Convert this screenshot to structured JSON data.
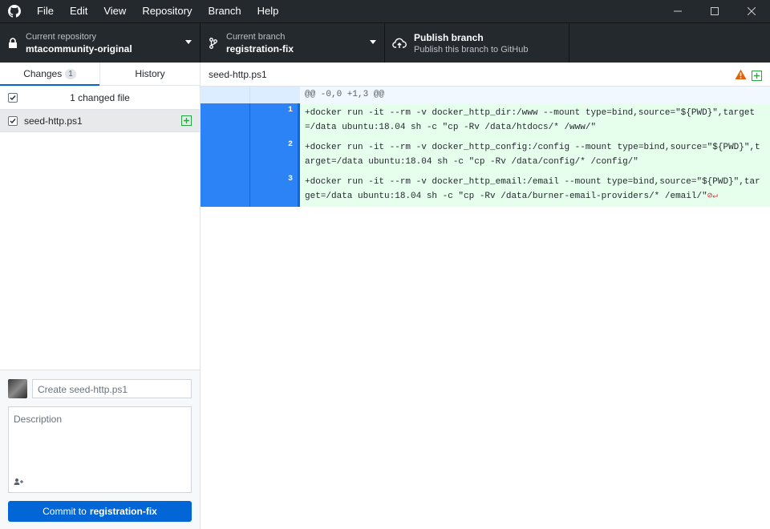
{
  "menu": [
    "File",
    "Edit",
    "View",
    "Repository",
    "Branch",
    "Help"
  ],
  "toolbar": {
    "repo_label": "Current repository",
    "repo_value": "mtacommunity-original",
    "branch_label": "Current branch",
    "branch_value": "registration-fix",
    "publish_title": "Publish branch",
    "publish_sub": "Publish this branch to GitHub"
  },
  "tabs": {
    "changes": "Changes",
    "changes_count": "1",
    "history": "History"
  },
  "changes": {
    "header": "1 changed file",
    "file": "seed-http.ps1"
  },
  "commit": {
    "summary_placeholder": "Create seed-http.ps1",
    "description_placeholder": "Description",
    "button_prefix": "Commit to",
    "button_branch": "registration-fix"
  },
  "diff": {
    "filename": "seed-http.ps1",
    "hunk": "@@ -0,0 +1,3 @@",
    "lines": [
      {
        "num": "1",
        "text": "+docker run -it --rm -v docker_http_dir:/www --mount type=bind,source=\"${PWD}\",target=/data ubuntu:18.04 sh -c \"cp -Rv /data/htdocs/* /www/\""
      },
      {
        "num": "2",
        "text": "+docker run -it --rm -v docker_http_config:/config --mount type=bind,source=\"${PWD}\",target=/data ubuntu:18.04 sh -c \"cp -Rv /data/config/* /config/\""
      },
      {
        "num": "3",
        "text": "+docker run -it --rm -v docker_http_email:/email --mount type=bind,source=\"${PWD}\",target=/data ubuntu:18.04 sh -c \"cp -Rv /data/burner-email-providers/* /email/\""
      }
    ],
    "eol_marker": "⊘↵"
  },
  "colors": {
    "accent": "#0366d6",
    "titlebar": "#24292e",
    "added": "#28a745",
    "warning": "#e36209"
  }
}
